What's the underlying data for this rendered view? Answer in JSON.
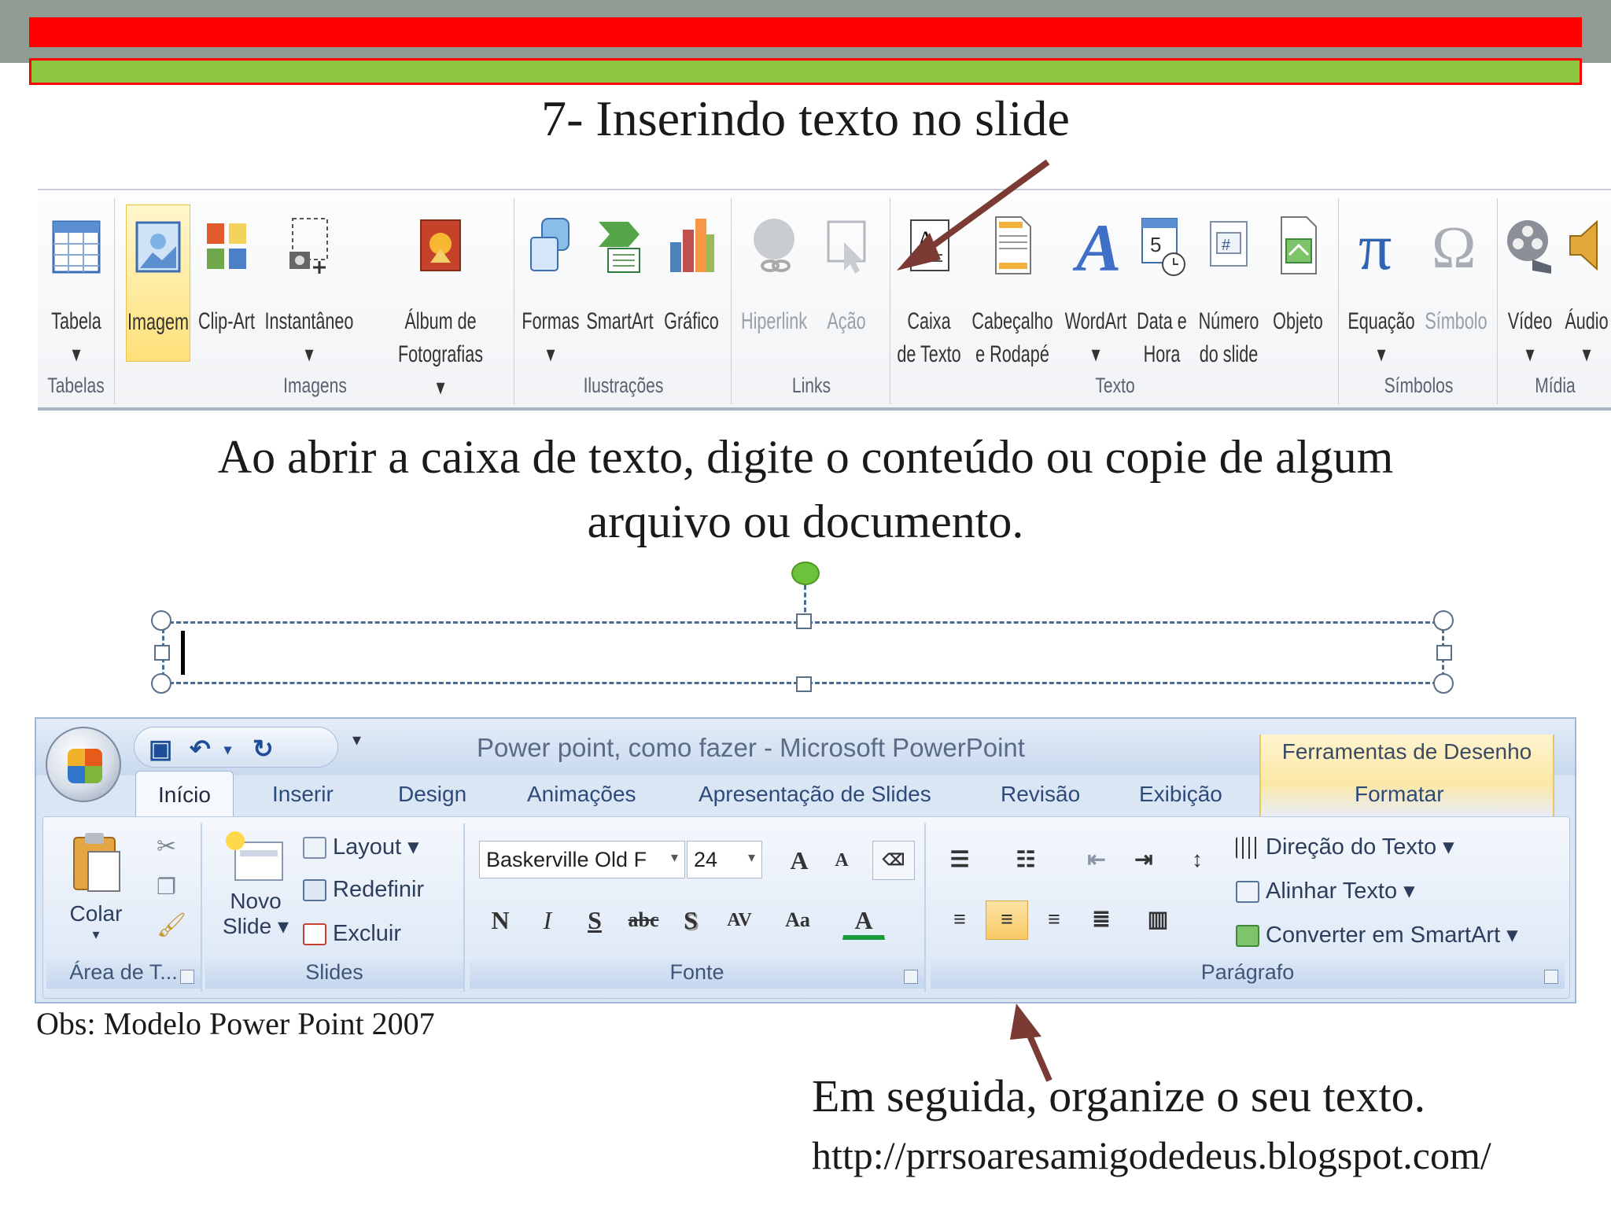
{
  "slide": {
    "title": "7- Inserindo texto no slide",
    "body_line1": "Ao abrir a caixa de texto, digite o conteúdo ou copie de algum",
    "body_line2": "arquivo ou documento.",
    "obs": "Obs: Modelo Power Point 2007",
    "bottom_text": "Em seguida, organize o seu texto.",
    "url": "http://prrsoaresamigodedeus.blogspot.com/"
  },
  "ribbon2010": {
    "groups": {
      "tabelas": "Tabelas",
      "imagens": "Imagens",
      "ilustracoes": "Ilustrações",
      "links": "Links",
      "texto": "Texto",
      "simbolos": "Símbolos",
      "midia": "Mídia"
    },
    "buttons": {
      "tabela": "Tabela\n▾",
      "imagem": "Imagem",
      "clipart": "Clip-Art",
      "instantaneo": "Instantâneo\n▾",
      "album": "Álbum de\nFotografias ▾",
      "formas": "Formas\n▾",
      "smartart": "SmartArt",
      "grafico": "Gráfico",
      "hiperlink": "Hiperlink",
      "acao": "Ação",
      "caixa_texto": "Caixa\nde Texto",
      "cabecalho": "Cabeçalho\ne Rodapé",
      "wordart": "WordArt\n▾",
      "data_hora": "Data e\nHora",
      "numero_slide": "Número\ndo slide",
      "objeto": "Objeto",
      "equacao": "Equação\n▾",
      "simbolo": "Símbolo",
      "video": "Vídeo\n▾",
      "audio": "Áudio\n▾"
    }
  },
  "office2007": {
    "window_title": "Power point, como fazer - Microsoft PowerPoint",
    "context_tools": "Ferramentas de Desenho",
    "tabs": {
      "inicio": "Início",
      "inserir": "Inserir",
      "design": "Design",
      "animacoes": "Animações",
      "apresentacao": "Apresentação de Slides",
      "revisao": "Revisão",
      "exibicao": "Exibição",
      "formatar": "Formatar"
    },
    "groups": {
      "area": "Área de T...",
      "slides": "Slides",
      "fonte": "Fonte",
      "paragrafo": "Parágrafo"
    },
    "buttons": {
      "colar": "Colar",
      "novo_slide_1": "Novo",
      "novo_slide_2": "Slide ▾",
      "layout": "Layout ▾",
      "redefinir": "Redefinir",
      "excluir": "Excluir",
      "direcao": "Direção do Texto ▾",
      "alinhar": "Alinhar Texto ▾",
      "converter": "Converter em SmartArt ▾"
    },
    "font_name": "Baskerville Old F",
    "font_size": "24",
    "font_buttons": {
      "grow": "A",
      "shrink": "A",
      "bold": "N",
      "italic": "I",
      "underline": "S",
      "strike": "abc",
      "shadow": "S",
      "spacing": "AV",
      "case": "Aa",
      "color": "A"
    }
  },
  "colors": {
    "red_bar": "#ff0000",
    "green_bar": "#8dc63f",
    "top_band": "#8f9c92",
    "arrow": "#7b3a34"
  }
}
